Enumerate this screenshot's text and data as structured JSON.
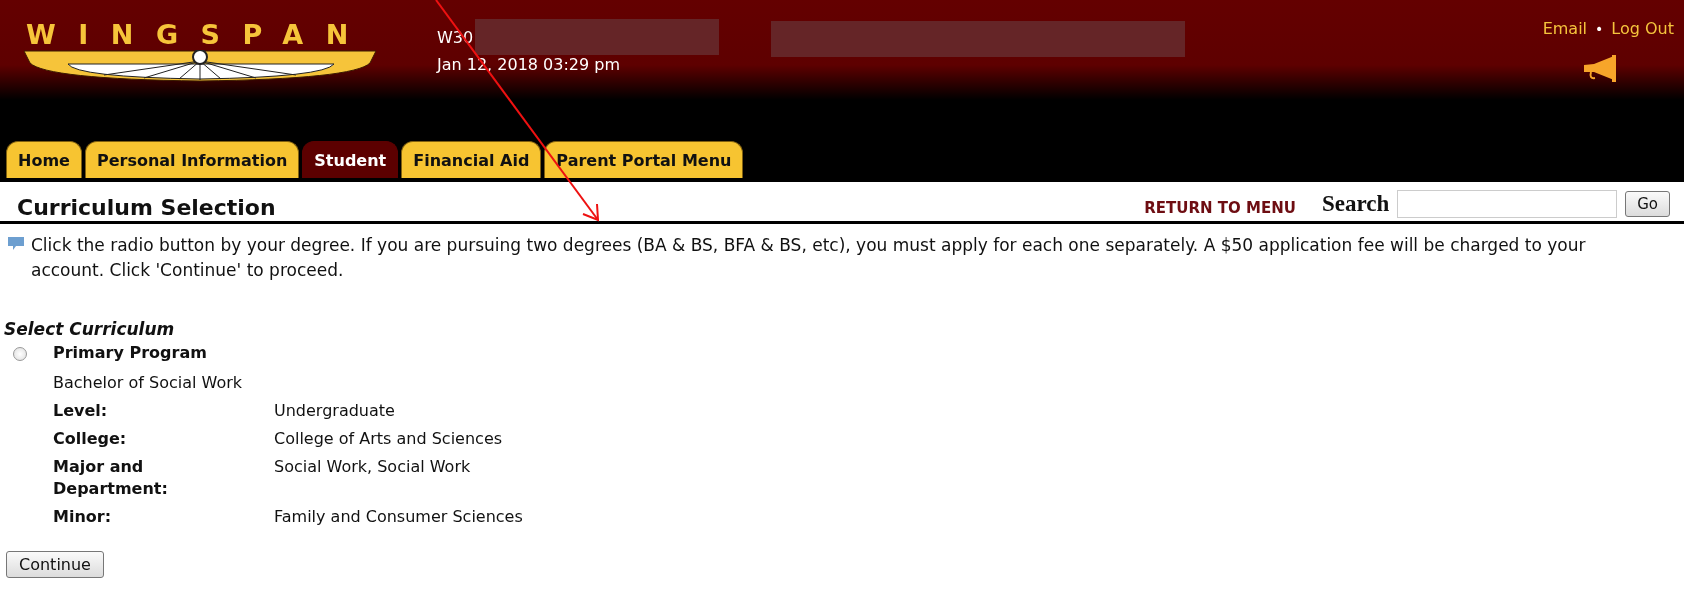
{
  "header": {
    "logo_text": "WINGSPAN",
    "user_id": "W30",
    "datetime": "Jan 12, 2018 03:29 pm",
    "links": [
      "Email",
      "Log Out"
    ],
    "separator": "•"
  },
  "tabs": [
    {
      "label": "Home",
      "selected": false
    },
    {
      "label": "Personal Information",
      "selected": false
    },
    {
      "label": "Student",
      "selected": true
    },
    {
      "label": "Financial Aid",
      "selected": false
    },
    {
      "label": "Parent Portal Menu",
      "selected": false
    }
  ],
  "page_title": "Curriculum Selection",
  "return_link": "RETURN TO MENU",
  "search": {
    "label": "Search",
    "button": "Go"
  },
  "info_text": "Click the radio button by your degree. If you are pursuing two degrees (BA & BS, BFA & BS, etc), you must apply for each one separately. A $50 application fee will be charged to your account. Click 'Continue' to proceed.",
  "section_title": "Select Curriculum",
  "programs": [
    {
      "title": "Primary Program",
      "selected": false,
      "name": "Bachelor of Social Work",
      "fields": [
        {
          "label": "Level:",
          "value": "Undergraduate"
        },
        {
          "label": "College:",
          "value": "College of Arts and Sciences"
        },
        {
          "label": "Major and Department:",
          "value": "Social Work, Social Work"
        },
        {
          "label": "Minor:",
          "value": "Family and Consumer Sciences"
        }
      ]
    }
  ],
  "buttons": [
    "Continue"
  ]
}
